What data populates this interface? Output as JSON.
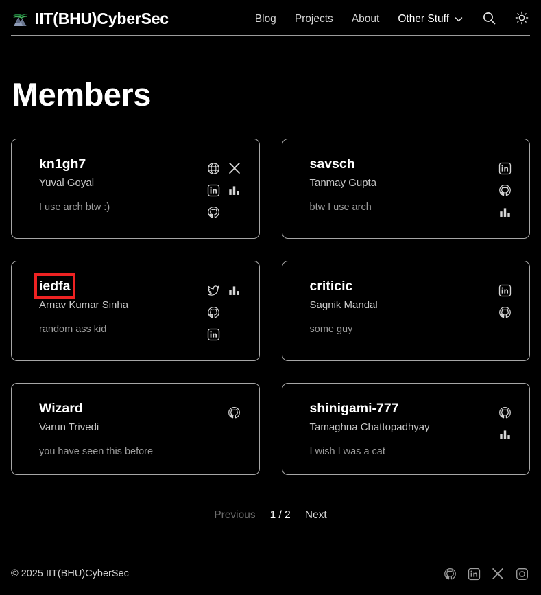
{
  "header": {
    "brand_name": "IIT(BHU)CyberSec",
    "logo_icon": "mountain-logo-icon",
    "nav": [
      {
        "label": "Blog",
        "icon": null,
        "active": false
      },
      {
        "label": "Projects",
        "icon": null,
        "active": false
      },
      {
        "label": "About",
        "icon": null,
        "active": false
      }
    ],
    "dropdown": {
      "label": "Other Stuff",
      "icon": "chevron-down-icon"
    },
    "search_icon": "search-icon",
    "theme_icon": "sun-icon"
  },
  "main": {
    "title": "Members",
    "members": [
      {
        "handle": "kn1gh7",
        "name": "Yuval Goyal",
        "bio": "I use arch btw :)",
        "highlighted": false,
        "icons": [
          "globe-icon",
          "x-icon",
          "linkedin-icon",
          "bar-chart-icon",
          "github-icon"
        ]
      },
      {
        "handle": "savsch",
        "name": "Tanmay Gupta",
        "bio": "btw I use arch",
        "highlighted": false,
        "icons": [
          "linkedin-icon",
          "github-icon",
          "bar-chart-icon"
        ]
      },
      {
        "handle": "iedfa",
        "name": "Arnav Kumar Sinha",
        "bio": "random ass kid",
        "highlighted": true,
        "icons": [
          "twitter-icon",
          "bar-chart-icon",
          "github-icon",
          "linkedin-icon"
        ]
      },
      {
        "handle": "criticic",
        "name": "Sagnik Mandal",
        "bio": "some guy",
        "highlighted": false,
        "icons": [
          "linkedin-icon",
          "github-icon"
        ]
      },
      {
        "handle": "Wizard",
        "name": "Varun Trivedi",
        "bio": "you have seen this before",
        "highlighted": false,
        "icons": [
          "github-icon"
        ]
      },
      {
        "handle": "shinigami-777",
        "name": "Tamaghna Chattopadhyay",
        "bio": "I wish I was a cat",
        "highlighted": false,
        "icons": [
          "github-icon",
          "bar-chart-icon"
        ]
      }
    ]
  },
  "pagination": {
    "previous_label": "Previous",
    "indicator": "1 / 2",
    "next_label": "Next",
    "current_page": 1,
    "total_pages": 2
  },
  "footer": {
    "copyright": "© 2025 IIT(BHU)CyberSec",
    "social": [
      "github-icon",
      "linkedin-icon",
      "x-icon",
      "instagram-icon"
    ]
  },
  "colors": {
    "background": "#000000",
    "card_border": "#a6a6a6",
    "text_primary": "#ffffff",
    "text_secondary": "#c8c8c8",
    "text_muted": "#9c9c9c",
    "highlight": "#ee2222"
  }
}
